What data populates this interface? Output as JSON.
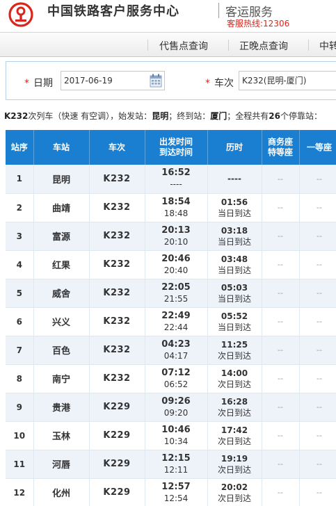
{
  "header": {
    "title": "中国铁路客户服务中心",
    "subtitle": "客运服务",
    "hotline": "客服热线:12306"
  },
  "nav": {
    "items": [
      "代售点查询",
      "正晚点查询",
      "中转"
    ]
  },
  "query": {
    "date_label": "日期",
    "date_value": "2017-06-19",
    "train_label": "车次",
    "train_value": "K232(昆明-厦门)"
  },
  "summary": {
    "train": "K232",
    "text1": "次列车（快速 有空调），始发站：",
    "origin": "昆明",
    "text2": "；终到站：",
    "terminal": "厦门",
    "text3": "；全程共有",
    "stop_count": "26",
    "text4": "个停靠站："
  },
  "table": {
    "headers": {
      "index": "站序",
      "station": "车站",
      "train": "车次",
      "time_line1": "出发时间",
      "time_line2": "到达时间",
      "duration": "历时",
      "seat1_line1": "商务座",
      "seat1_line2": "特等座",
      "seat2": "一等座"
    },
    "rows": [
      {
        "idx": "1",
        "station": "昆明",
        "train": "K232",
        "depart": "16:52",
        "arrive": "----",
        "dur": "----",
        "day": "",
        "s1": "--",
        "s2": "--"
      },
      {
        "idx": "2",
        "station": "曲靖",
        "train": "K232",
        "depart": "18:54",
        "arrive": "18:48",
        "dur": "01:56",
        "day": "当日到达",
        "s1": "--",
        "s2": "--"
      },
      {
        "idx": "3",
        "station": "富源",
        "train": "K232",
        "depart": "20:13",
        "arrive": "20:10",
        "dur": "03:18",
        "day": "当日到达",
        "s1": "--",
        "s2": "--"
      },
      {
        "idx": "4",
        "station": "红果",
        "train": "K232",
        "depart": "20:46",
        "arrive": "20:40",
        "dur": "03:48",
        "day": "当日到达",
        "s1": "--",
        "s2": "--"
      },
      {
        "idx": "5",
        "station": "威舍",
        "train": "K232",
        "depart": "22:05",
        "arrive": "21:55",
        "dur": "05:03",
        "day": "当日到达",
        "s1": "--",
        "s2": "--"
      },
      {
        "idx": "6",
        "station": "兴义",
        "train": "K232",
        "depart": "22:49",
        "arrive": "22:44",
        "dur": "05:52",
        "day": "当日到达",
        "s1": "--",
        "s2": "--"
      },
      {
        "idx": "7",
        "station": "百色",
        "train": "K232",
        "depart": "04:23",
        "arrive": "04:17",
        "dur": "11:25",
        "day": "次日到达",
        "s1": "--",
        "s2": "--"
      },
      {
        "idx": "8",
        "station": "南宁",
        "train": "K232",
        "depart": "07:12",
        "arrive": "06:52",
        "dur": "14:00",
        "day": "次日到达",
        "s1": "--",
        "s2": "--"
      },
      {
        "idx": "9",
        "station": "贵港",
        "train": "K229",
        "depart": "09:26",
        "arrive": "09:20",
        "dur": "16:28",
        "day": "次日到达",
        "s1": "--",
        "s2": "--"
      },
      {
        "idx": "10",
        "station": "玉林",
        "train": "K229",
        "depart": "10:46",
        "arrive": "10:34",
        "dur": "17:42",
        "day": "次日到达",
        "s1": "--",
        "s2": "--"
      },
      {
        "idx": "11",
        "station": "河唇",
        "train": "K229",
        "depart": "12:15",
        "arrive": "12:11",
        "dur": "19:19",
        "day": "次日到达",
        "s1": "--",
        "s2": "--"
      },
      {
        "idx": "12",
        "station": "化州",
        "train": "K229",
        "depart": "12:57",
        "arrive": "12:54",
        "dur": "20:02",
        "day": "次日到达",
        "s1": "--",
        "s2": "--"
      }
    ]
  },
  "colors": {
    "accent": "#1b7fd1",
    "logo_red": "#d9261c",
    "row_alt": "#eef3fa"
  }
}
